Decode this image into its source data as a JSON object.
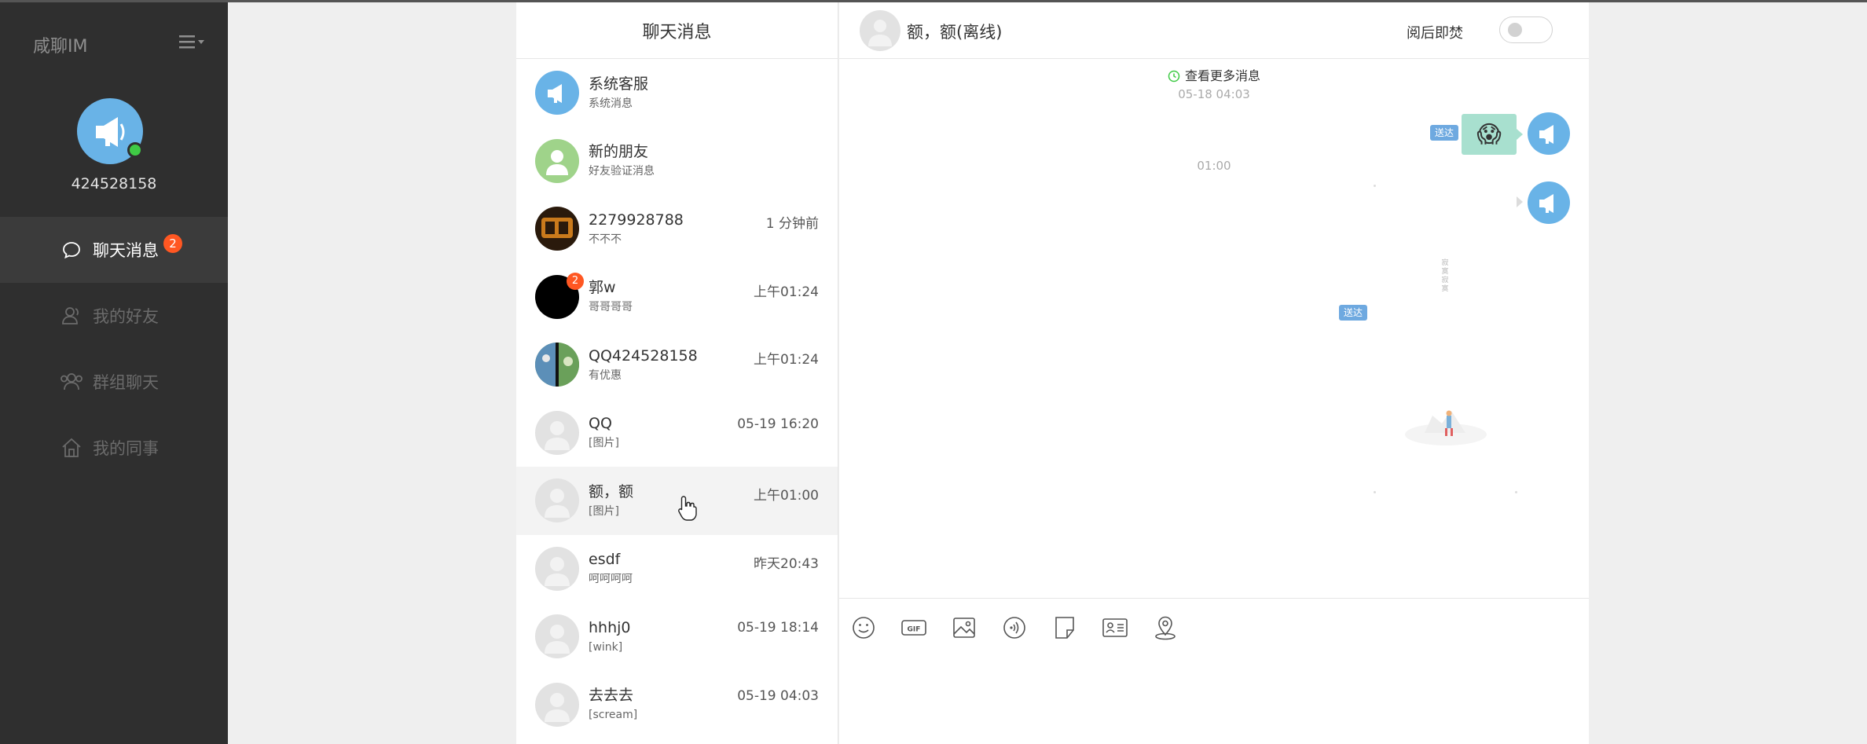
{
  "app": {
    "brand": "咸聊IM"
  },
  "user": {
    "id": "424528158"
  },
  "nav": {
    "items": [
      {
        "label": "聊天消息",
        "icon": "chat-bubble-icon",
        "badge": "2",
        "active": true
      },
      {
        "label": "我的好友",
        "icon": "user-icon",
        "active": false
      },
      {
        "label": "群组聊天",
        "icon": "group-icon",
        "active": false
      },
      {
        "label": "我的同事",
        "icon": "home-icon",
        "active": false
      }
    ]
  },
  "chat_list": {
    "title": "聊天消息",
    "items": [
      {
        "name": "系统客服",
        "sub": "系统消息",
        "time": "",
        "badge": "",
        "avatar": "megaphone"
      },
      {
        "name": "新的朋友",
        "sub": "好友验证消息",
        "time": "",
        "badge": "",
        "avatar": "green"
      },
      {
        "name": "2279928788",
        "sub": "不不不",
        "time": "1 分钟前",
        "badge": "",
        "avatar": "dark-art"
      },
      {
        "name": "郭w",
        "sub": "哥哥哥哥",
        "time": "上午01:24",
        "badge": "2",
        "avatar": "black"
      },
      {
        "name": "QQ424528158",
        "sub": "有优惠",
        "time": "上午01:24",
        "badge": "",
        "avatar": "photo"
      },
      {
        "name": "QQ",
        "sub": "[图片]",
        "time": "05-19 16:20",
        "badge": "",
        "avatar": "default"
      },
      {
        "name": "额，额",
        "sub": "[图片]",
        "time": "上午01:00",
        "badge": "",
        "avatar": "default"
      },
      {
        "name": "esdf",
        "sub": "呵呵呵呵",
        "time": "昨天20:43",
        "badge": "",
        "avatar": "default"
      },
      {
        "name": "hhhj0",
        "sub": "[wink]",
        "time": "05-19 18:14",
        "badge": "",
        "avatar": "default"
      },
      {
        "name": "去去去",
        "sub": "[scream]",
        "time": "05-19 04:03",
        "badge": "",
        "avatar": "default"
      }
    ]
  },
  "conversation": {
    "title": "额，额(离线)",
    "burn_after_read_label": "阅后即焚",
    "burn_after_read_on": false,
    "more_messages": "查看更多消息",
    "time1": "05-18 04:03",
    "time2": "01:00",
    "sent_tag": "送达",
    "emoji": "😱",
    "vertical_text": "寂寞寂寞"
  },
  "toolbar": {
    "tools": [
      "emoji-icon",
      "gif-icon",
      "image-icon",
      "voice-icon",
      "file-icon",
      "contact-card-icon",
      "location-icon"
    ]
  },
  "colors": {
    "accent": "#69b3e7",
    "badge": "#ff5722",
    "sidebar": "#2f2f2f",
    "online": "#3fca45"
  }
}
